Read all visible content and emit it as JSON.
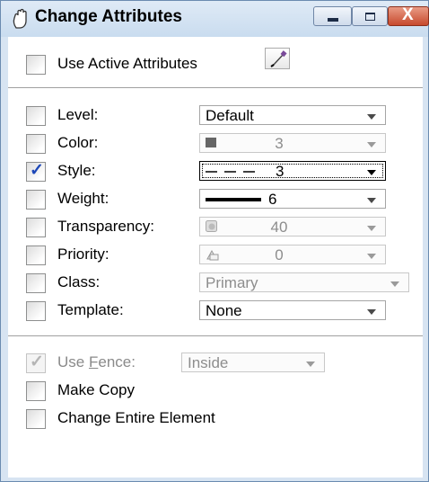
{
  "window": {
    "title": "Change Attributes",
    "title_icon": "hand-icon",
    "buttons": {
      "minimize": "minimize",
      "maximize": "maximize",
      "close": "X"
    }
  },
  "use_active": {
    "label": "Use Active Attributes",
    "checked": false,
    "pick_icon": "eyedropper-icon"
  },
  "attributes": [
    {
      "key": "level",
      "label": "Level:",
      "checked": false,
      "value": "Default",
      "enabled": true
    },
    {
      "key": "color",
      "label": "Color:",
      "checked": false,
      "value": "3",
      "enabled": false,
      "icon": "color-swatch-icon",
      "swatch_color": "#666666"
    },
    {
      "key": "style",
      "label": "Style:",
      "checked": true,
      "value": "3",
      "enabled": true,
      "icon": "dashed-line-icon",
      "focused": true
    },
    {
      "key": "weight",
      "label": "Weight:",
      "checked": false,
      "value": "6",
      "enabled": false,
      "icon": "thick-line-icon"
    },
    {
      "key": "transparency",
      "label": "Transparency:",
      "checked": false,
      "value": "40",
      "enabled": false,
      "icon": "transparency-icon"
    },
    {
      "key": "priority",
      "label": "Priority:",
      "checked": false,
      "value": "0",
      "enabled": false,
      "icon": "priority-icon"
    },
    {
      "key": "class",
      "label": "Class:",
      "checked": false,
      "value": "Primary",
      "enabled": false
    },
    {
      "key": "template",
      "label": "Template:",
      "checked": false,
      "value": "None",
      "enabled": true
    }
  ],
  "fence": {
    "label": "Use Fence:",
    "mnemonic": "F",
    "checked": true,
    "enabled": false,
    "mode": "Inside"
  },
  "make_copy": {
    "label": "Make Copy",
    "checked": false
  },
  "change_entire": {
    "label": "Change Entire Element",
    "checked": false
  },
  "colors": {
    "title_bg": "#c9dcef",
    "check_mark": "#1c47b8",
    "disabled_text": "#8a8a8a"
  }
}
